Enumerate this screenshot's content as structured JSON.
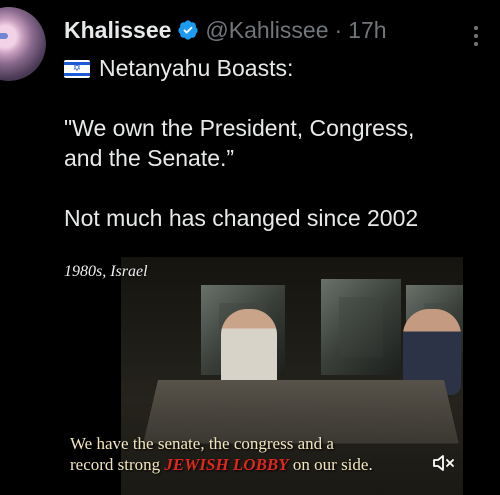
{
  "post": {
    "display_name": "Khalissee",
    "handle": "@Kahlissee",
    "time": "17h",
    "separator": "·",
    "verified": true,
    "text_line1": "Netanyahu Boasts:",
    "text_line2": "\"We own the President, Congress,",
    "text_line3": "and the Senate.”",
    "text_line4": "Not much has changed since 2002"
  },
  "media": {
    "caption_top": "1980s, Israel",
    "subtitle_line1": "We have the senate, the congress and a",
    "subtitle_line2_before": "record strong ",
    "subtitle_line2_highlight": "JEWISH LOBBY",
    "subtitle_line2_after": " on our side.",
    "mute_icon": "speaker-muted-icon"
  },
  "colors": {
    "background": "#000000",
    "text": "#e7e9ea",
    "secondary": "#71767b",
    "verified_blue": "#1d9bf0",
    "lobby_red": "#e1261c"
  }
}
